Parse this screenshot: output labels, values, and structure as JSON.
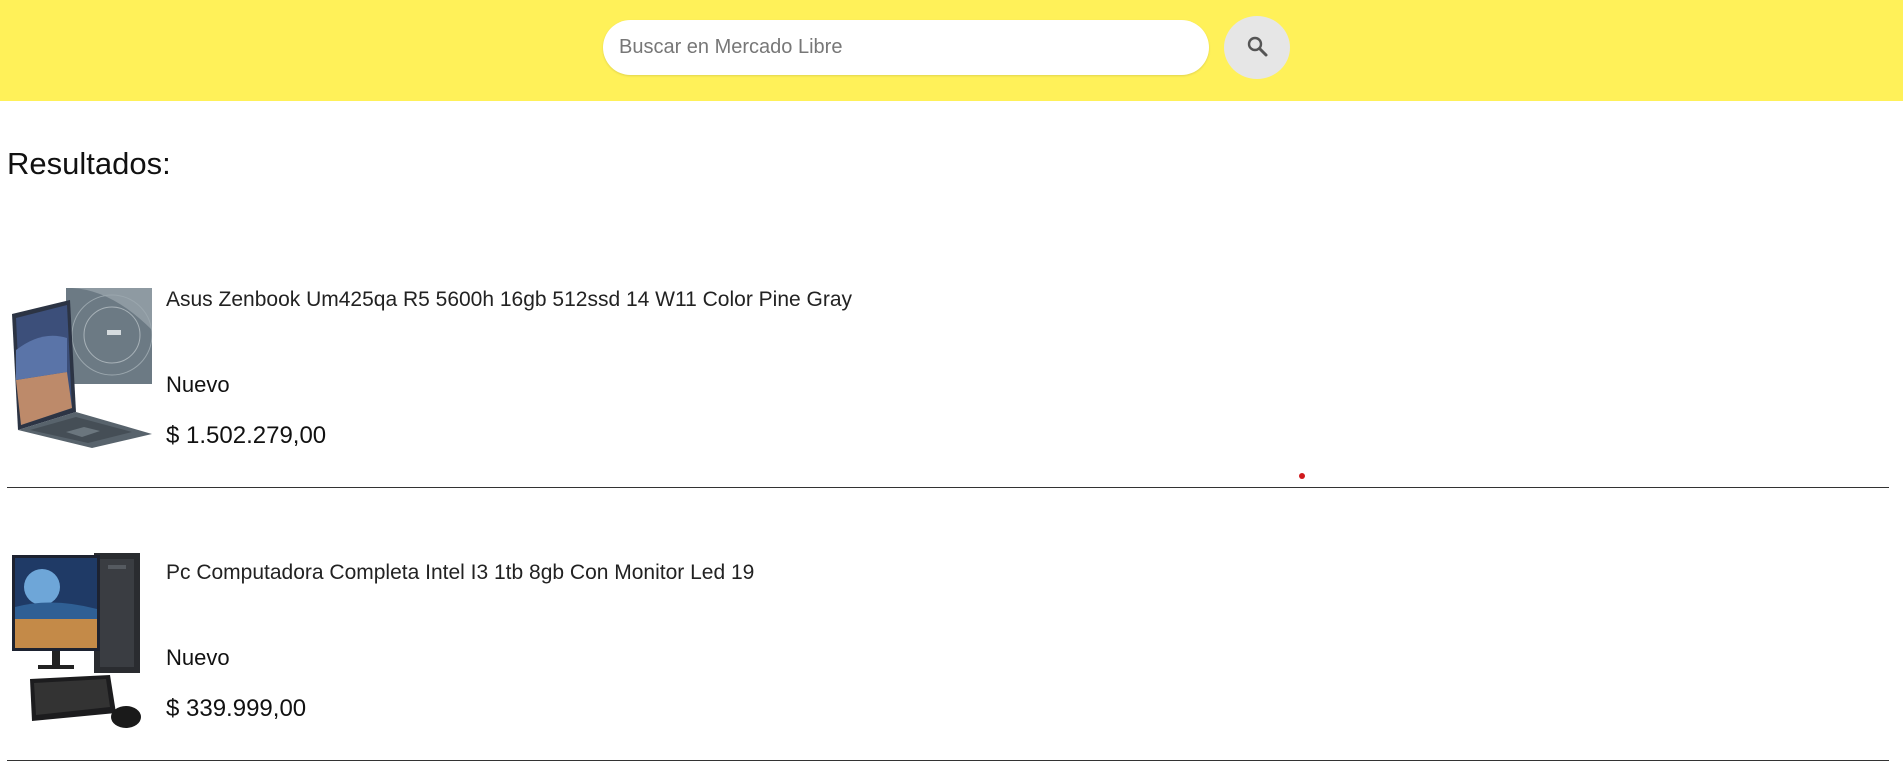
{
  "header": {
    "background_color": "#fff159",
    "search": {
      "placeholder": "Buscar en Mercado Libre",
      "value": ""
    },
    "search_button_icon": "search-icon"
  },
  "main": {
    "results_title": "Resultados:",
    "items": [
      {
        "title": "Asus Zenbook Um425qa R5 5600h 16gb 512ssd 14 W11 Color Pine Gray",
        "condition": "Nuevo",
        "price": "$ 1.502.279,00",
        "thumbnail": "laptop-thumbnail"
      },
      {
        "title": "Pc Computadora Completa Intel I3 1tb 8gb Con Monitor Led 19",
        "condition": "Nuevo",
        "price": "$ 339.999,00",
        "thumbnail": "desktop-pc-thumbnail"
      }
    ]
  }
}
